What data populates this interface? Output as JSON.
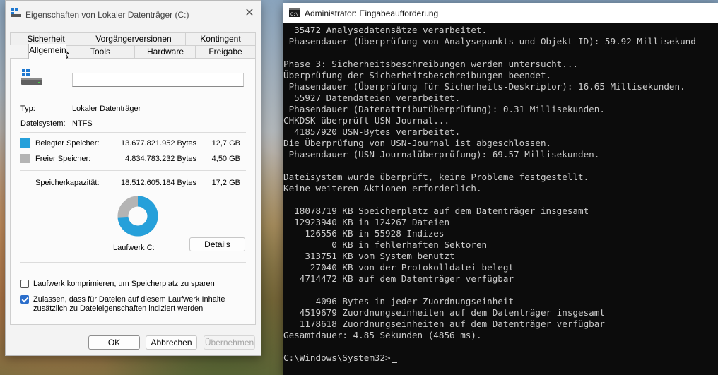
{
  "dialog": {
    "title": "Eigenschaften von Lokaler Datenträger (C:)",
    "tabs_row1": [
      "Sicherheit",
      "Vorgängerversionen",
      "Kontingent"
    ],
    "tabs_row2": [
      "Allgemein",
      "Tools",
      "Hardware",
      "Freigabe"
    ],
    "active_tab": "Allgemein",
    "name_value": "",
    "type_label": "Typ:",
    "type_value": "Lokaler Datenträger",
    "fs_label": "Dateisystem:",
    "fs_value": "NTFS",
    "used": {
      "label": "Belegter Speicher:",
      "bytes": "13.677.821.952 Bytes",
      "size": "12,7 GB",
      "color": "#26a0da"
    },
    "free": {
      "label": "Freier Speicher:",
      "bytes": "4.834.783.232 Bytes",
      "size": "4,50 GB",
      "color": "#b4b4b4"
    },
    "capacity": {
      "label": "Speicherkapazität:",
      "bytes": "18.512.605.184 Bytes",
      "size": "17,2 GB"
    },
    "used_fraction": 0.7388,
    "drive_label": "Laufwerk C:",
    "details_button": "Details",
    "compress_label": "Laufwerk komprimieren, um Speicherplatz zu sparen",
    "compress_checked": false,
    "index_label_line1": "Zulassen, dass für Dateien auf diesem Laufwerk Inhalte",
    "index_label_line2": "zusätzlich zu Dateieigenschaften indiziert werden",
    "index_checked": true,
    "ok": "OK",
    "cancel": "Abbrechen",
    "apply": "Übernehmen"
  },
  "console": {
    "title": "Administrator: Eingabeaufforderung",
    "lines": [
      "  35472 Analysedatensätze verarbeitet.",
      " Phasendauer (Überprüfung von Analysepunkts und Objekt-ID): 59.92 Millisekund",
      "",
      "Phase 3: Sicherheitsbeschreibungen werden untersucht...",
      "Überprüfung der Sicherheitsbeschreibungen beendet.",
      " Phasendauer (Überprüfung für Sicherheits-Deskriptor): 16.65 Millisekunden.",
      "  55927 Datendateien verarbeitet.",
      " Phasendauer (Datenattributüberprüfung): 0.31 Millisekunden.",
      "CHKDSK überprüft USN-Journal...",
      "  41857920 USN-Bytes verarbeitet.",
      "Die Überprüfung von USN-Journal ist abgeschlossen.",
      " Phasendauer (USN-Journalüberprüfung): 69.57 Millisekunden.",
      "",
      "Dateisystem wurde überprüft, keine Probleme festgestellt.",
      "Keine weiteren Aktionen erforderlich.",
      "",
      "  18078719 KB Speicherplatz auf dem Datenträger insgesamt",
      "  12923940 KB in 124267 Dateien",
      "    126556 KB in 55928 Indizes",
      "         0 KB in fehlerhaften Sektoren",
      "    313751 KB vom System benutzt",
      "     27040 KB von der Protokolldatei belegt",
      "   4714472 KB auf dem Datenträger verfügbar",
      "",
      "      4096 Bytes in jeder Zuordnungseinheit",
      "   4519679 Zuordnungseinheiten auf dem Datenträger insgesamt",
      "   1178618 Zuordnungseinheiten auf dem Datenträger verfügbar",
      "Gesamtdauer: 4.85 Sekunden (4856 ms).",
      "",
      "C:\\Windows\\System32>"
    ]
  }
}
